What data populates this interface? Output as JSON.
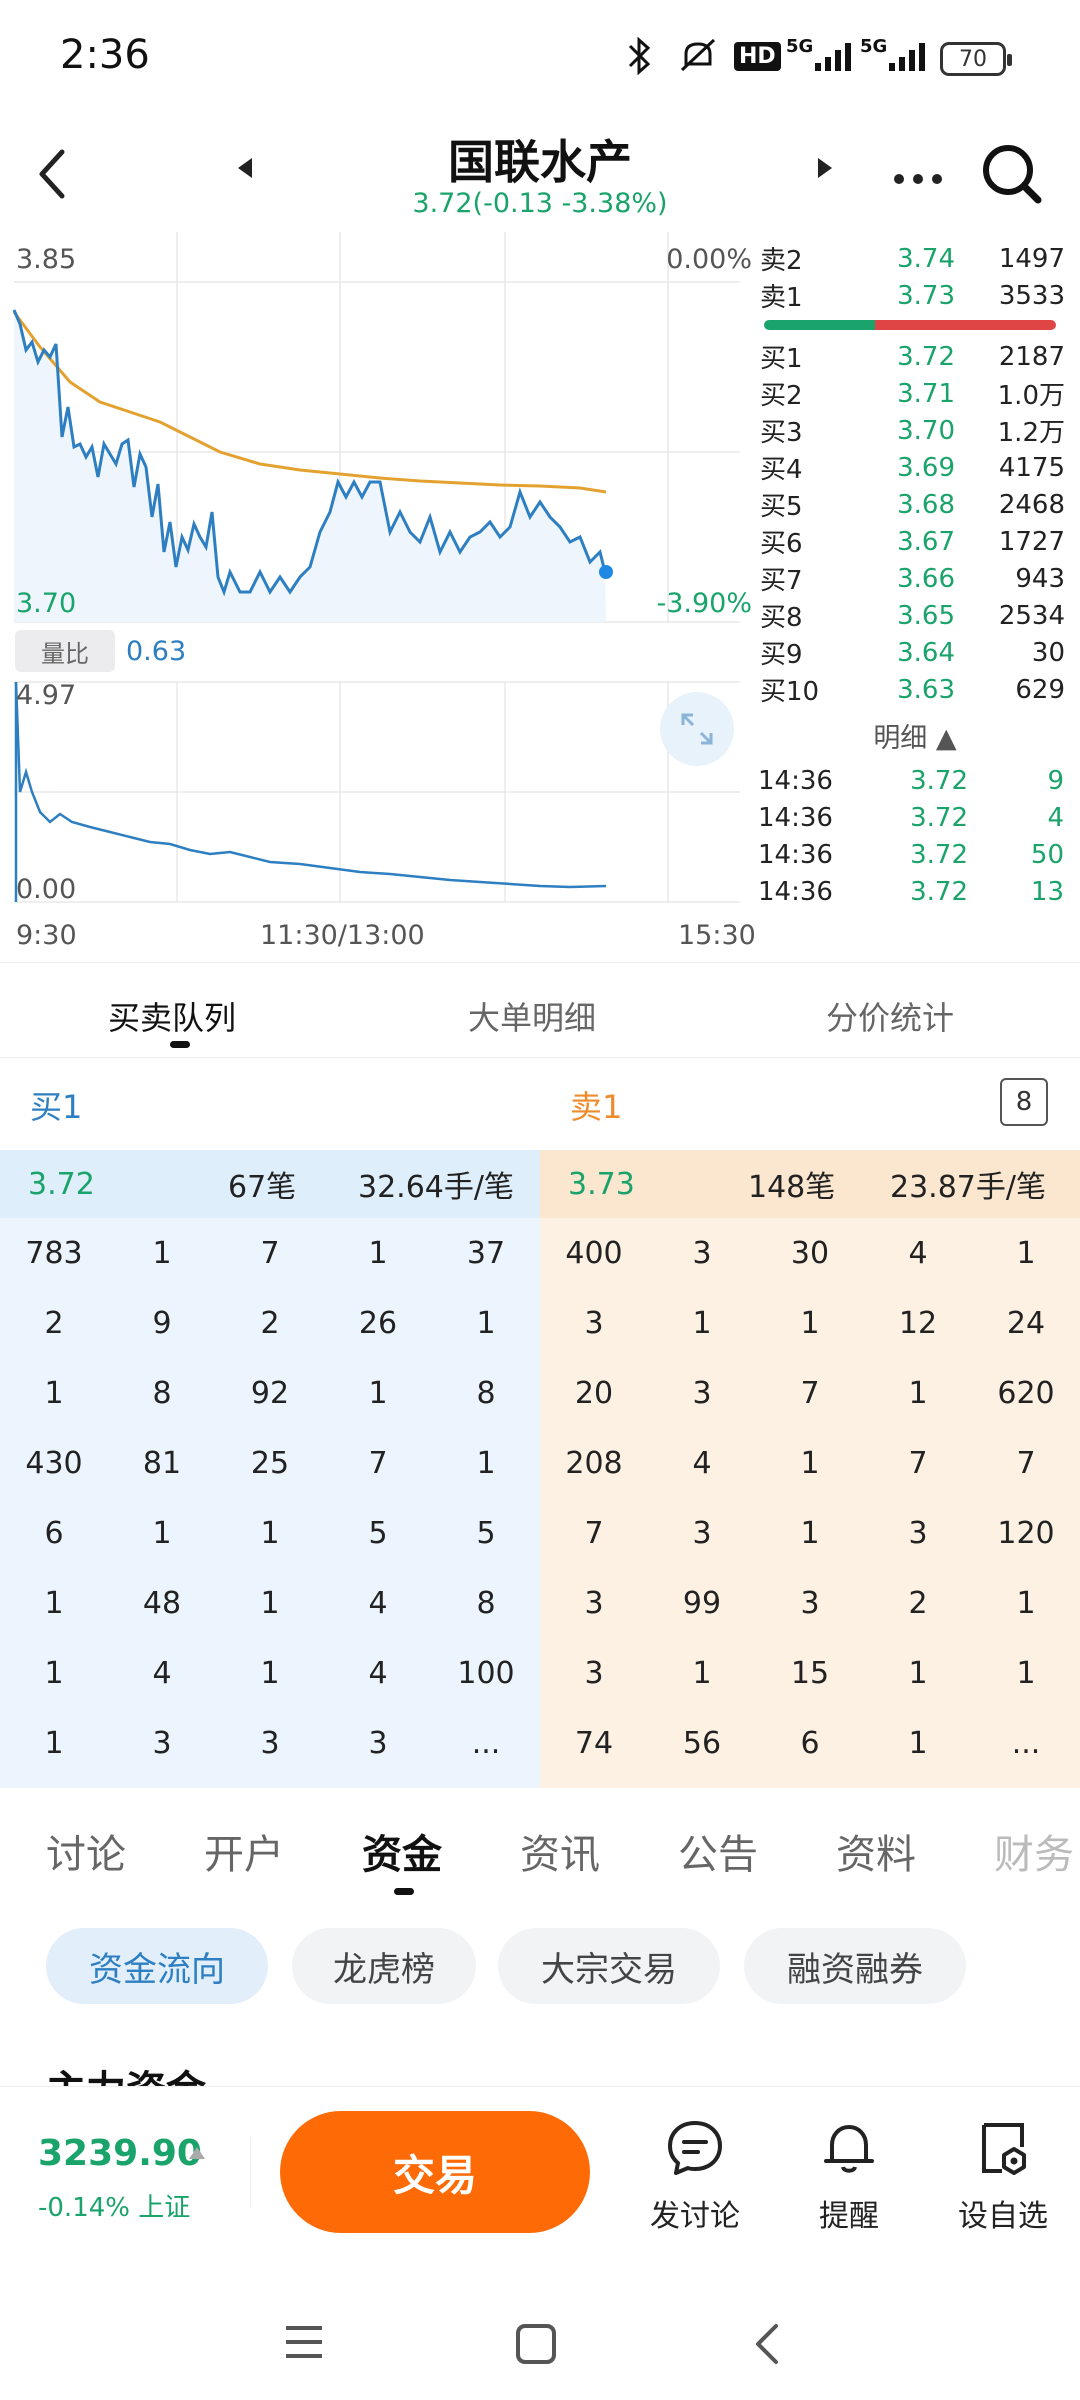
{
  "status_bar": {
    "time": "2:36",
    "battery": "70",
    "network1": "5G",
    "network2": "5G",
    "hd": "HD"
  },
  "header": {
    "title": "国联水产",
    "subtitle": "3.72(-0.13 -3.38%)"
  },
  "chart": {
    "price_high": "3.85",
    "price_low": "3.70",
    "pct_high": "0.00%",
    "pct_low": "-3.90%",
    "ratio_label": "量比",
    "ratio_value": "0.63",
    "vol_high": "4.97",
    "vol_low": "0.00",
    "time_start": "9:30",
    "time_mid": "11:30/13:00",
    "time_end": "15:30"
  },
  "orderbook": {
    "asks": [
      {
        "label": "卖2",
        "price": "3.74",
        "volume": "1497"
      },
      {
        "label": "卖1",
        "price": "3.73",
        "volume": "3533"
      }
    ],
    "bids": [
      {
        "label": "买1",
        "price": "3.72",
        "volume": "2187"
      },
      {
        "label": "买2",
        "price": "3.71",
        "volume": "1.0万"
      },
      {
        "label": "买3",
        "price": "3.70",
        "volume": "1.2万"
      },
      {
        "label": "买4",
        "price": "3.69",
        "volume": "4175"
      },
      {
        "label": "买5",
        "price": "3.68",
        "volume": "2468"
      },
      {
        "label": "买6",
        "price": "3.67",
        "volume": "1727"
      },
      {
        "label": "买7",
        "price": "3.66",
        "volume": "943"
      },
      {
        "label": "买8",
        "price": "3.65",
        "volume": "2534"
      },
      {
        "label": "买9",
        "price": "3.64",
        "volume": "30"
      },
      {
        "label": "买10",
        "price": "3.63",
        "volume": "629"
      }
    ],
    "detail_label": "明细 ▲",
    "trades": [
      {
        "time": "14:36",
        "price": "3.72",
        "volume": "9"
      },
      {
        "time": "14:36",
        "price": "3.72",
        "volume": "4"
      },
      {
        "time": "14:36",
        "price": "3.72",
        "volume": "50"
      },
      {
        "time": "14:36",
        "price": "3.72",
        "volume": "13"
      }
    ]
  },
  "queue_tabs": [
    "买卖队列",
    "大单明细",
    "分价统计"
  ],
  "queue": {
    "buy_label": "买1",
    "sell_label": "卖1",
    "badge": "8",
    "buy_head": {
      "price": "3.72",
      "count": "67笔",
      "avg": "32.64手/笔"
    },
    "sell_head": {
      "price": "3.73",
      "count": "148笔",
      "avg": "23.87手/笔"
    },
    "buy_cells": [
      "783",
      "1",
      "7",
      "1",
      "37",
      "2",
      "9",
      "2",
      "26",
      "1",
      "1",
      "8",
      "92",
      "1",
      "8",
      "430",
      "81",
      "25",
      "7",
      "1",
      "6",
      "1",
      "1",
      "5",
      "5",
      "1",
      "48",
      "1",
      "4",
      "8",
      "1",
      "4",
      "1",
      "4",
      "100",
      "1",
      "3",
      "3",
      "3",
      "..."
    ],
    "sell_cells": [
      "400",
      "3",
      "30",
      "4",
      "1",
      "3",
      "1",
      "1",
      "12",
      "24",
      "20",
      "3",
      "7",
      "1",
      "620",
      "208",
      "4",
      "1",
      "7",
      "7",
      "7",
      "3",
      "1",
      "3",
      "120",
      "3",
      "99",
      "3",
      "2",
      "1",
      "3",
      "1",
      "15",
      "1",
      "1",
      "74",
      "56",
      "6",
      "1",
      "..."
    ]
  },
  "section_tabs": [
    "讨论",
    "开户",
    "资金",
    "资讯",
    "公告",
    "资料",
    "财务"
  ],
  "chips": [
    "资金流向",
    "龙虎榜",
    "大宗交易",
    "融资融券"
  ],
  "partial_heading": "主力资金",
  "bottom": {
    "index_value": "3239.90",
    "index_change": "-0.14% 上证",
    "trade_label": "交易",
    "discuss_label": "发讨论",
    "alert_label": "提醒",
    "watch_label": "设自选"
  },
  "colors": {
    "up": "#e04545",
    "down": "#1aa36a",
    "accent": "#fe6a05",
    "line_price": "#2d7fc1",
    "line_avg": "#e3a230"
  }
}
